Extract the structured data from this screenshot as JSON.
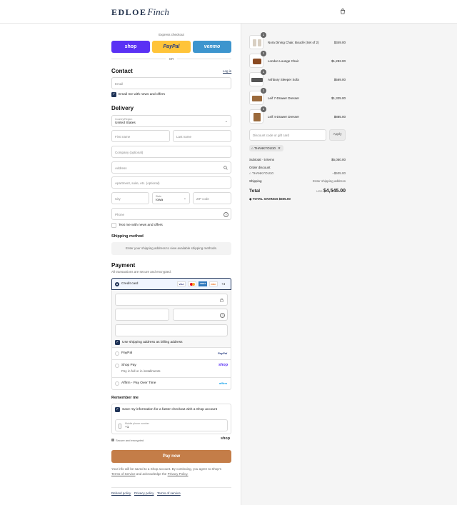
{
  "brand": {
    "name": "EDLOE",
    "script": "Finch"
  },
  "express": {
    "title": "Express checkout",
    "shop": "shop",
    "paypal": "PayPal",
    "venmo": "venmo",
    "or": "OR"
  },
  "contact": {
    "title": "Contact",
    "login": "Log in",
    "email_placeholder": "Email",
    "news_label": "Email me with news and offers"
  },
  "delivery": {
    "title": "Delivery",
    "country_label": "Country/Region",
    "country_value": "United States",
    "first_name": "First name",
    "last_name": "Last name",
    "company": "Company (optional)",
    "address": "Address",
    "apartment": "Apartment, suite, etc. (optional)",
    "city": "City",
    "state_label": "State",
    "state_value": "Iowa",
    "zip": "ZIP code",
    "phone": "Phone",
    "text_label": "Text me with news and offers"
  },
  "shipping": {
    "title": "Shipping method",
    "notice": "Enter your shipping address to view available shipping methods."
  },
  "payment": {
    "title": "Payment",
    "subtitle": "All transactions are secure and encrypted.",
    "credit_card": "Credit card",
    "cards": [
      "VISA",
      "MC",
      "AMEX",
      "DISC"
    ],
    "more_cards": "+4",
    "billing_label": "Use shipping address as billing address",
    "paypal": "PayPal",
    "paypal_logo": "PayPal",
    "shop_pay": "Shop Pay",
    "shop_pay_sub": "Pay in full or in installments",
    "shop_logo": "shop",
    "affirm": "Affirm - Pay Over Time",
    "affirm_logo": "affirm"
  },
  "remember": {
    "title": "Remember me",
    "save_label": "Save my information for a faster checkout with a Shop account",
    "phone_label": "Mobile phone number",
    "phone_value": "+1",
    "secure": "Secure and encrypted",
    "shop_logo": "shop"
  },
  "paynow": {
    "label": "Pay now"
  },
  "legal": {
    "line1": "Your info will be saved to a Shop account. By continuing, you agree to Shop's",
    "terms": "Terms of Service",
    "line2": "and acknowledge the",
    "privacy": "Privacy Policy."
  },
  "footer": {
    "refund": "Refund policy",
    "privacy": "Privacy policy",
    "terms": "Terms of service"
  },
  "cart": {
    "items": [
      {
        "qty": "1",
        "name": "Nora Dining Chair, Bouclé (Set of 2)",
        "price": "$349.00"
      },
      {
        "qty": "1",
        "name": "London Lounge Chair",
        "price": "$1,282.00"
      },
      {
        "qty": "1",
        "name": "Ashbury Sleeper Sofa",
        "price": "$569.00"
      },
      {
        "qty": "1",
        "name": "Leif 7-Drawer Dresser",
        "price": "$1,325.00"
      },
      {
        "qty": "1",
        "name": "Leif 4-Drawer Dresser",
        "price": "$885.00"
      }
    ],
    "discount_placeholder": "Discount code or gift card",
    "apply": "Apply",
    "code": "THANKYOU10",
    "subtotal_label": "Subtotal · 5 items",
    "subtotal": "$5,050.00",
    "order_discount": "Order discount",
    "discount_code": "THANKYOU10",
    "discount_value": "−$505.00",
    "shipping_label": "Shipping",
    "shipping_value": "Enter shipping address",
    "total_label": "Total",
    "currency": "USD",
    "total": "$4,545.00",
    "savings_label": "TOTAL SAVINGS",
    "savings": "$505.00"
  }
}
